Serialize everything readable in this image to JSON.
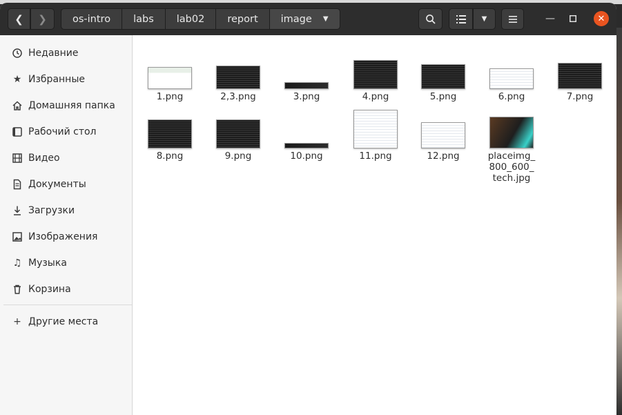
{
  "window": {
    "pathbar": [
      "os-intro",
      "labs",
      "lab02",
      "report",
      "image"
    ],
    "icons": {
      "back": "chevron-left-icon",
      "forward": "chevron-right-icon",
      "search": "search-icon",
      "view": "list-view-icon",
      "view_menu": "chevron-down-icon",
      "menu": "hamburger-menu-icon",
      "minimize": "minimize-icon",
      "maximize": "maximize-icon",
      "close": "close-icon"
    },
    "colors": {
      "headerbar": "#2d2d2d",
      "close": "#e95420",
      "sidebar": "#f6f6f6"
    }
  },
  "sidebar": {
    "items": [
      {
        "label": "Недавние",
        "icon": "clock-icon"
      },
      {
        "label": "Избранные",
        "icon": "star-icon"
      },
      {
        "label": "Домашняя папка",
        "icon": "home-icon"
      },
      {
        "label": "Рабочий стол",
        "icon": "desktop-icon"
      },
      {
        "label": "Видео",
        "icon": "film-icon"
      },
      {
        "label": "Документы",
        "icon": "document-icon"
      },
      {
        "label": "Загрузки",
        "icon": "download-icon"
      },
      {
        "label": "Изображения",
        "icon": "image-icon"
      },
      {
        "label": "Музыка",
        "icon": "music-icon"
      },
      {
        "label": "Корзина",
        "icon": "trash-icon"
      }
    ],
    "other": {
      "label": "Другие места",
      "icon": "plus-icon"
    }
  },
  "files": [
    {
      "name": "1.png"
    },
    {
      "name": "2,3.png"
    },
    {
      "name": "3.png"
    },
    {
      "name": "4.png"
    },
    {
      "name": "5.png"
    },
    {
      "name": "6.png"
    },
    {
      "name": "7.png"
    },
    {
      "name": "8.png"
    },
    {
      "name": "9.png"
    },
    {
      "name": "10.png"
    },
    {
      "name": "11.png"
    },
    {
      "name": "12.png"
    },
    {
      "name": "placeimg_ 800_600_ tech.jpg"
    }
  ]
}
